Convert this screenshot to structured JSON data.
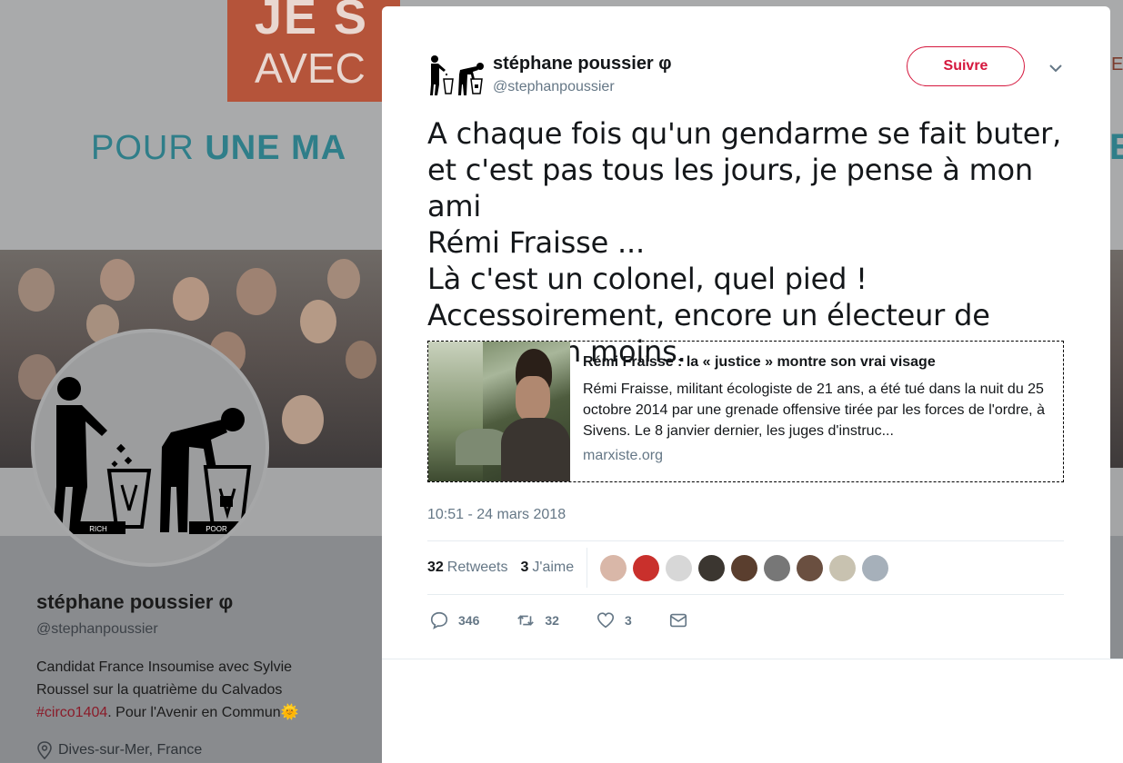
{
  "background_profile": {
    "banner_text_line1": "JE S",
    "banner_text_line2": "AVEC",
    "banner_pour": "POUR ",
    "banner_pour_bold": "UNE MA",
    "banner_right_letter": "E",
    "banner_right_small": "E",
    "name": "stéphane poussier φ",
    "handle": "@stephanpoussier",
    "bio_part1": "Candidat France Insoumise avec Sylvie Roussel sur la quatrième du Calvados ",
    "bio_hashtag": "#circo1404",
    "bio_part2": ". Pour l'Avenir en Commun",
    "bio_emoji": "🌞",
    "location": "Dives-sur-Mer, France",
    "avatar_labels": [
      "RICH",
      "POOR"
    ]
  },
  "tweet": {
    "author_name": "stéphane poussier φ",
    "author_handle": "@stephanpoussier",
    "follow_label": "Suivre",
    "text": "A chaque fois qu'un gendarme se fait buter,\net c'est pas tous les jours, je pense à mon ami\nRémi Fraisse ...\nLà c'est un colonel, quel pied !\nAccessoirement, encore un électeur de\nmacron en moins.",
    "card": {
      "title": "Rémi Fraisse : la « justice » montre son vrai visage",
      "description": "Rémi Fraisse, militant écologiste de 21 ans, a été tué dans la nuit du 25 octobre 2014 par une grenade offensive tirée par les forces de l'ordre, à Sivens. Le 8 janvier dernier, les juges d'instruc...",
      "domain": "marxiste.org"
    },
    "timestamp": "10:51 - 24 mars 2018",
    "stats": {
      "retweets_count": "32",
      "retweets_label": "Retweets",
      "likes_count": "3",
      "likes_label": "J'aime"
    },
    "likers": [
      "#d9b7a8",
      "#c9302c",
      "#d7d7d7",
      "#3b3630",
      "#5a3e2e",
      "#777777",
      "#6a4f40",
      "#c8c2b0",
      "#a6b0ba"
    ],
    "actions": {
      "replies": "346",
      "retweets": "32",
      "likes": "3"
    }
  },
  "colors": {
    "accent": "#d5173d",
    "muted": "#657786",
    "text": "#14171a"
  }
}
